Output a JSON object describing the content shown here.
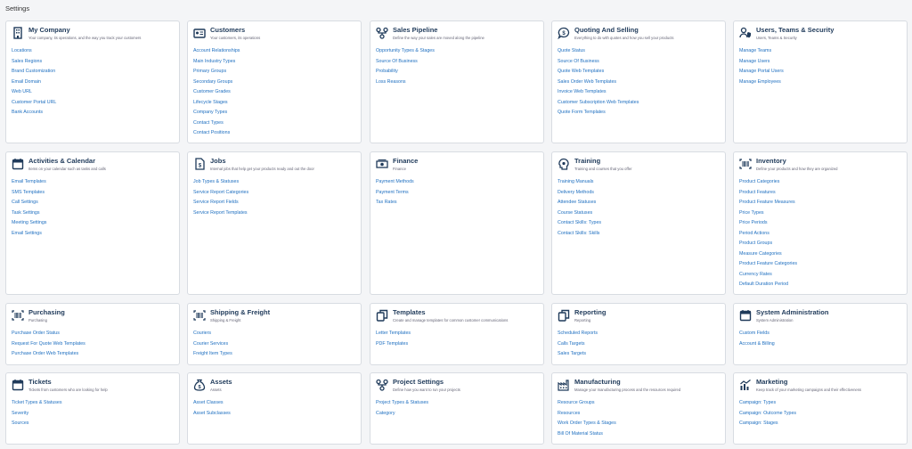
{
  "page_title": "Settings",
  "cards": [
    {
      "title": "My Company",
      "subtitle": "Your company, its operations, and the way you track your customers",
      "icon": "building-icon",
      "links": [
        "Locations",
        "Sales Regions",
        "Brand Customization",
        "Email Domain",
        "Web URL",
        "Customer Portal URL",
        "Bank Accounts"
      ]
    },
    {
      "title": "Customers",
      "subtitle": "Your customers, its operations",
      "icon": "id-card-icon",
      "links": [
        "Account Relationships",
        "Main Industry Types",
        "Primary Groups",
        "Secondary Groups",
        "Customer Grades",
        "Lifecycle Stages",
        "Company Types",
        "Contact Types",
        "Contact Positions"
      ]
    },
    {
      "title": "Sales Pipeline",
      "subtitle": "Define the way your sales are moved along the pipeline",
      "icon": "pipeline-icon",
      "links": [
        "Opportunity Types & Stages",
        "Source Of Business",
        "Probability",
        "Loss Reasons"
      ]
    },
    {
      "title": "Quoting And Selling",
      "subtitle": "Everything to do with quotes and how you sell your products",
      "icon": "dollar-chat-icon",
      "links": [
        "Quote Status",
        "Source Of Business",
        "Quote Web Templates",
        "Sales Order Web Templates",
        "Invoice Web Templates",
        "Customer Subscription Web Templates",
        "Quote Form Templates"
      ]
    },
    {
      "title": "Users, Teams & Security",
      "subtitle": "Users, Teams & Security",
      "icon": "users-shield-icon",
      "links": [
        "Manage Teams",
        "Manage Users",
        "Manage Portal Users",
        "Manage Employees"
      ]
    },
    {
      "title": "Activities & Calendar",
      "subtitle": "Items on your calendar such as tasks and calls",
      "icon": "calendar-icon",
      "links": [
        "Email Templates",
        "SMS Templates",
        "Call Settings",
        "Task Settings",
        "Meeting Settings",
        "Email Settings"
      ]
    },
    {
      "title": "Jobs",
      "subtitle": "Internal jobs that help get your products ready and out the door",
      "icon": "dollar-doc-icon",
      "links": [
        "Job Types & Statuses",
        "Service Report Categories",
        "Service Report Fields",
        "Service Report Templates"
      ]
    },
    {
      "title": "Finance",
      "subtitle": "Finance",
      "icon": "money-icon",
      "links": [
        "Payment Methods",
        "Payment Terms",
        "Tax Rates"
      ]
    },
    {
      "title": "Training",
      "subtitle": "Training and courses that you offer",
      "icon": "head-gear-icon",
      "links": [
        "Training Manuals",
        "Delivery Methods",
        "Attendee Statuses",
        "Course Statuses",
        "Contact Skills: Types",
        "Contact Skills: Skills"
      ]
    },
    {
      "title": "Inventory",
      "subtitle": "Define your products and how they are organized",
      "icon": "barcode-icon",
      "links": [
        "Product Categories",
        "Product Features",
        "Product Feature Measures",
        "Price Types",
        "Price Periods",
        "Period Actions",
        "Product Groups",
        "Measure Categories",
        "Product Feature Categories",
        "Currency Rates",
        "Default Duration Period"
      ]
    },
    {
      "title": "Purchasing",
      "subtitle": "Purchasing",
      "icon": "barcode-icon",
      "links": [
        "Purchase Order Status",
        "Request For Quote Web Templates",
        "Purchase Order Web Templates"
      ]
    },
    {
      "title": "Shipping & Freight",
      "subtitle": "Shipping & Freight",
      "icon": "barcode-icon",
      "links": [
        "Couriers",
        "Courier Services",
        "Freight Item Types"
      ]
    },
    {
      "title": "Templates",
      "subtitle": "Create and manage templates for common customer communications",
      "icon": "copy-icon",
      "links": [
        "Letter Templates",
        "PDF Templates"
      ]
    },
    {
      "title": "Reporting",
      "subtitle": "Reporting",
      "icon": "copy-icon",
      "links": [
        "Scheduled Reports",
        "Calls Targets",
        "Sales Targets"
      ]
    },
    {
      "title": "System Administration",
      "subtitle": "System Administration",
      "icon": "calendar-icon",
      "links": [
        "Custom Fields",
        "Account & Billing"
      ]
    },
    {
      "title": "Tickets",
      "subtitle": "Tickets from customers who are looking for help",
      "icon": "calendar-icon",
      "links": [
        "Ticket Types & Statuses",
        "Severity",
        "Sources"
      ]
    },
    {
      "title": "Assets",
      "subtitle": "Assets",
      "icon": "money-bag-icon",
      "links": [
        "Asset Classes",
        "Asset Subclasses"
      ]
    },
    {
      "title": "Project Settings",
      "subtitle": "Define how you want to run your projects",
      "icon": "pipeline-icon",
      "links": [
        "Project Types & Statuses",
        "Category"
      ]
    },
    {
      "title": "Manufacturing",
      "subtitle": "Manage your manufacturing process and the resources required",
      "icon": "factory-icon",
      "links": [
        "Resource Groups",
        "Resources",
        "Work Order Types & Stages",
        "Bill Of Material Status"
      ]
    },
    {
      "title": "Marketing",
      "subtitle": "Keep track of your marketing campaigns and their effectiveness",
      "icon": "chart-icon",
      "links": [
        "Campaign: Types",
        "Campaign: Outcome Types",
        "Campaign: Stages"
      ]
    }
  ]
}
